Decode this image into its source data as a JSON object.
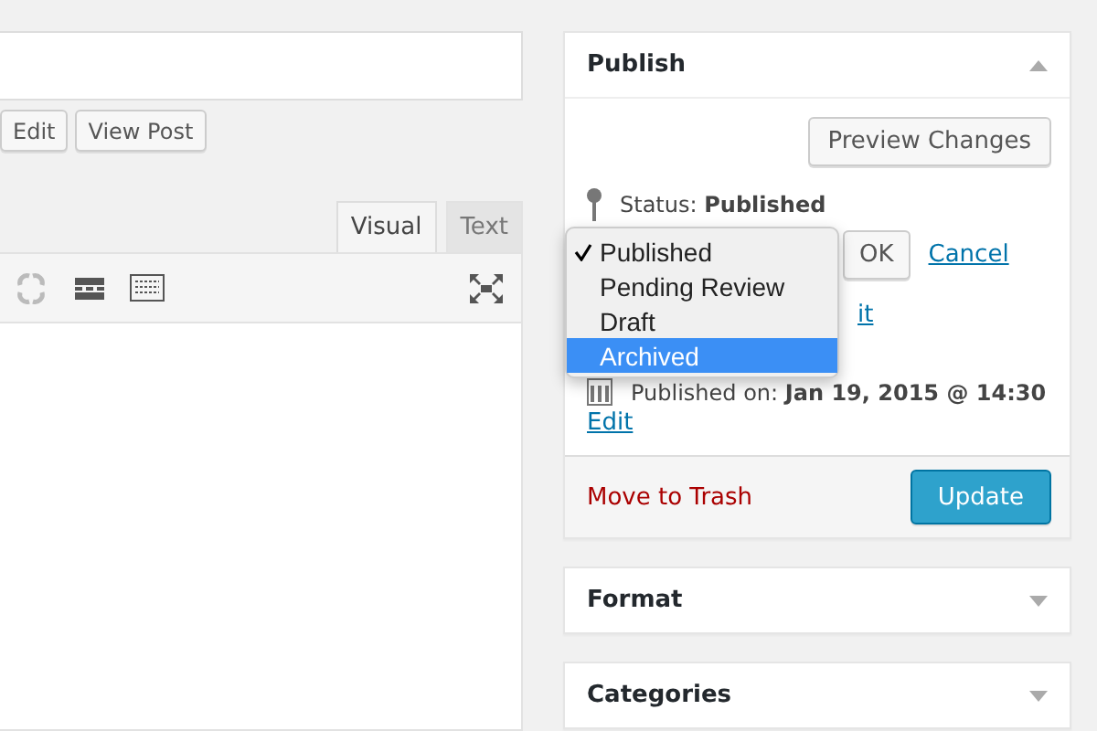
{
  "post_actions": [
    "Edit",
    "View Post"
  ],
  "editor_tabs": [
    {
      "label": "Visual",
      "selected": true
    },
    {
      "label": "Text",
      "selected": false
    }
  ],
  "publish": {
    "title": "Publish",
    "preview_button": "Preview Changes",
    "status_label": "Status:",
    "status_value": "Published",
    "status_dropdown": [
      {
        "label": "Published",
        "selected": true,
        "highlighted": false
      },
      {
        "label": "Pending Review",
        "selected": false,
        "highlighted": false
      },
      {
        "label": "Draft",
        "selected": false,
        "highlighted": false
      },
      {
        "label": "Archived",
        "selected": false,
        "highlighted": true
      }
    ],
    "ok_button": "OK",
    "cancel_link": "Cancel",
    "visibility_edit_fragment": "it",
    "published_on": "Published on: **Jan 19, 2015 @ 14:30**",
    "published_edit": "Edit",
    "trash_link": "Move to Trash",
    "update_button": "Update"
  },
  "boxes": [
    {
      "title": "Format"
    },
    {
      "title": "Categories"
    }
  ]
}
